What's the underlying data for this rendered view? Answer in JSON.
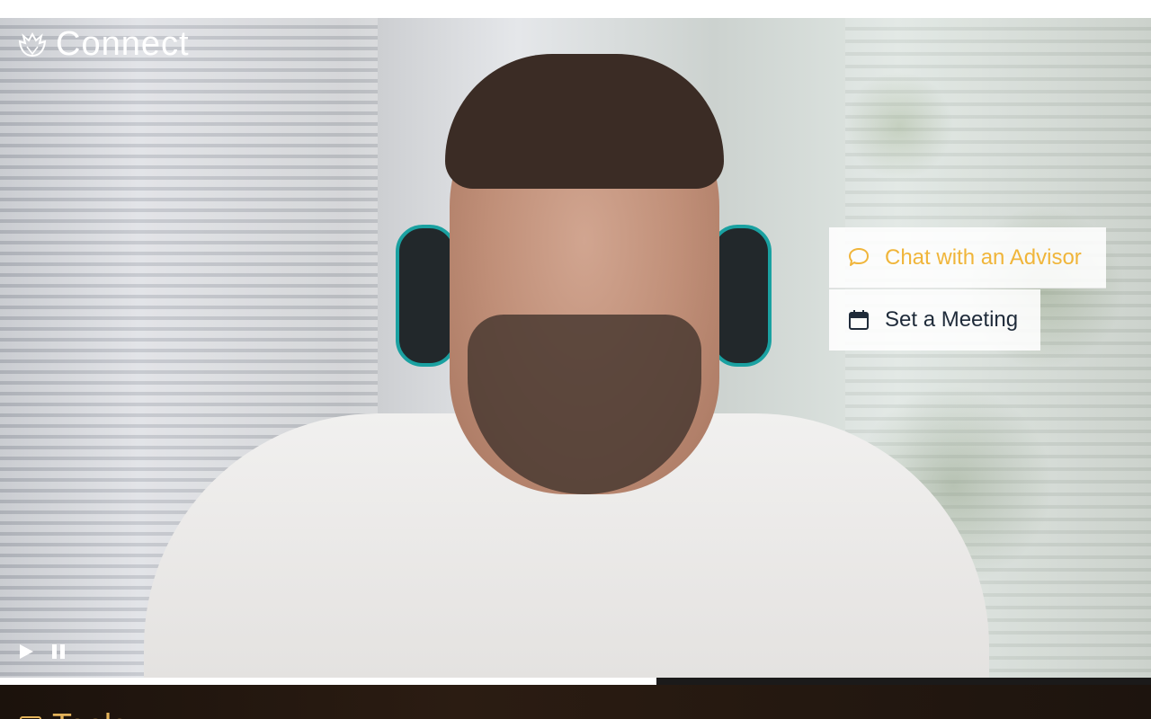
{
  "header": {
    "brand": "Connect",
    "brand_icon": "shell-logo-icon"
  },
  "hero": {
    "description_icon_left": "person-photo"
  },
  "actions": {
    "chat_label": "Chat with an Advisor",
    "chat_icon": "chat-bubble-icon",
    "meeting_label": "Set a Meeting",
    "meeting_icon": "calendar-icon"
  },
  "video": {
    "play_icon": "play-icon",
    "pause_icon": "pause-icon",
    "progress_percent": 57
  },
  "bottom": {
    "heading": "Tools",
    "icon": "document-icon"
  },
  "colors": {
    "accent": "#f0b53a",
    "text_dark": "#1f2b3a",
    "panel_dark": "#1b120c"
  }
}
